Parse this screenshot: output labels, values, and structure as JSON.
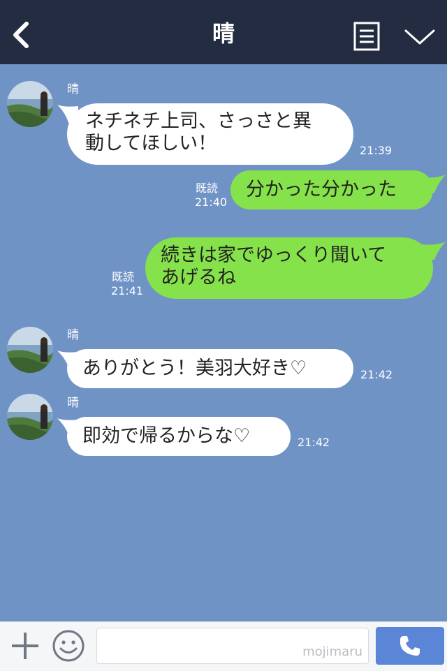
{
  "header": {
    "title": "晴",
    "back_icon": "chevron-left-icon",
    "menu_icon": "notes-icon",
    "more_icon": "chevron-down-icon"
  },
  "messages": [
    {
      "direction": "incoming",
      "sender": "晴",
      "text": "ネチネチ上司、さっさと異\n動してほしい！",
      "time": "21:39"
    },
    {
      "direction": "outgoing",
      "read": "既読",
      "text": "分かった分かった",
      "time": "21:40"
    },
    {
      "direction": "outgoing",
      "read": "既読",
      "text": "続きは家でゆっくり聞いて\nあげるね",
      "time": "21:41"
    },
    {
      "direction": "incoming",
      "sender": "晴",
      "text": "ありがとう！美羽大好き♡",
      "time": "21:42"
    },
    {
      "direction": "incoming",
      "sender": "晴",
      "text": "即効で帰るからな♡",
      "time": "21:42"
    }
  ],
  "footer": {
    "plus_icon": "plus-icon",
    "emoji_icon": "smile-icon",
    "input_value": "",
    "watermark": "mojimaru",
    "call_icon": "phone-icon"
  },
  "colors": {
    "header_bg": "#232c40",
    "chat_bg": "#7093c6",
    "outgoing_bubble": "#86e24a",
    "incoming_bubble": "#ffffff",
    "call_button": "#5b86d8"
  }
}
